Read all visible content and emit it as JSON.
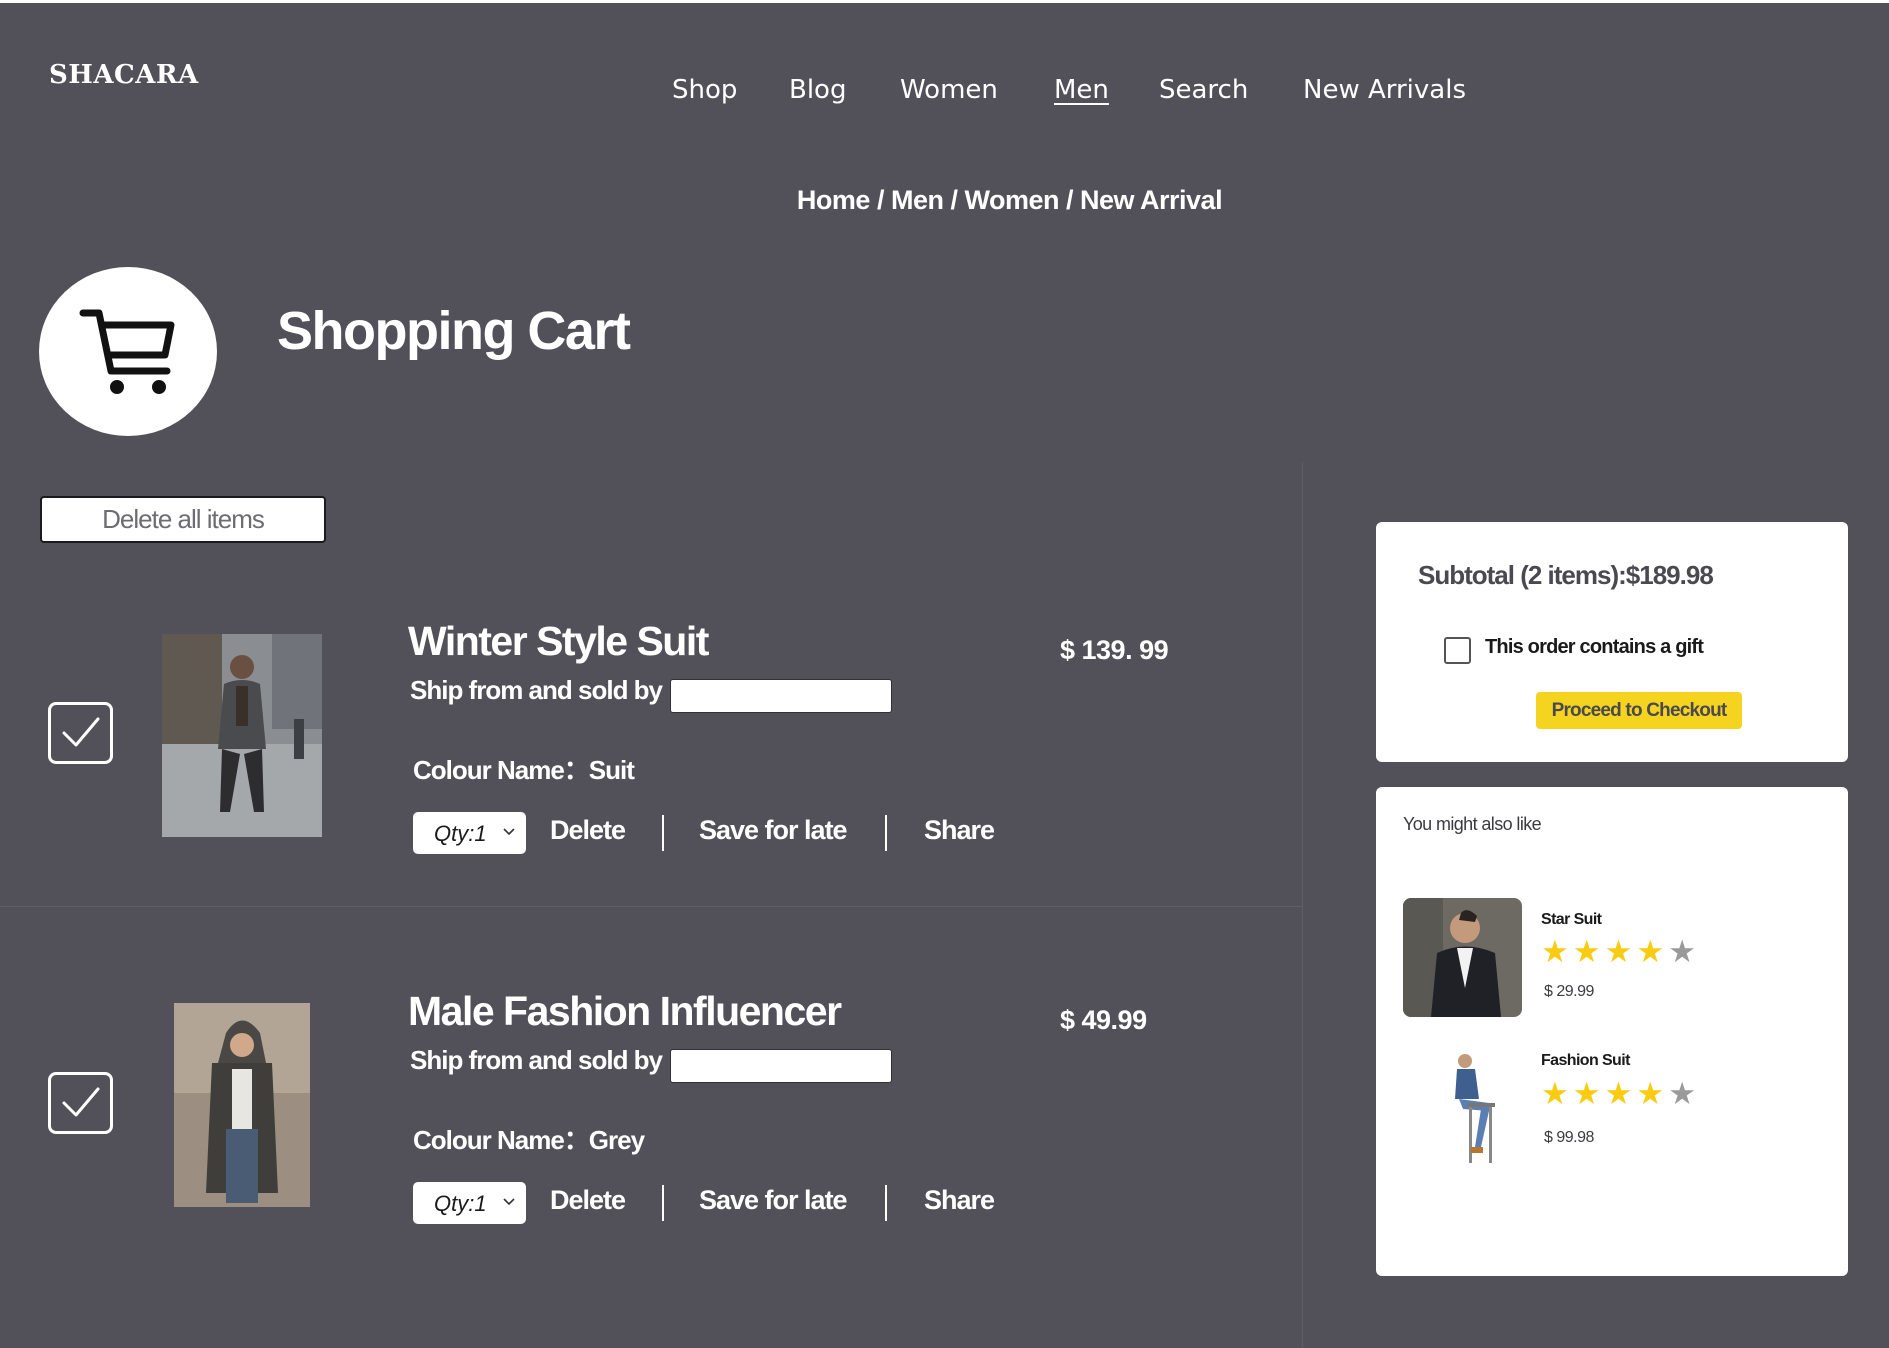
{
  "header": {
    "logo": "SHACARA",
    "nav": [
      {
        "label": "Shop",
        "active": false
      },
      {
        "label": "Blog",
        "active": false
      },
      {
        "label": "Women",
        "active": false
      },
      {
        "label": "Men",
        "active": true
      },
      {
        "label": "Search",
        "active": false
      },
      {
        "label": "New Arrivals",
        "active": false
      }
    ]
  },
  "breadcrumb": [
    "Home",
    "Men",
    "Women",
    "New Arrival"
  ],
  "page": {
    "title": "Shopping Cart",
    "delete_all_label": "Delete all items"
  },
  "cart_items": [
    {
      "name": "Winter Style Suit",
      "ship_label": "Ship from and sold by",
      "price": "$ 139. 99",
      "colour": "Colour Name：Suit",
      "qty": "Qty:1",
      "checked": true,
      "actions": {
        "delete": "Delete",
        "save": "Save for late",
        "share": "Share"
      }
    },
    {
      "name": "Male Fashion Influencer",
      "ship_label": "Ship from and sold by",
      "price": "$ 49.99",
      "colour": "Colour Name：Grey",
      "qty": "Qty:1",
      "checked": true,
      "actions": {
        "delete": "Delete",
        "save": "Save for late",
        "share": "Share"
      }
    }
  ],
  "summary": {
    "subtotal": "Subtotal (2 items):$189.98",
    "gift_label": "This order contains a gift",
    "gift_checked": false,
    "checkout_label": "Proceed to Checkout"
  },
  "recommendations": {
    "title": "You might also like",
    "items": [
      {
        "name": "Star Suit",
        "rating": 4,
        "max_rating": 5,
        "price": "$ 29.99"
      },
      {
        "name": "Fashion Suit",
        "rating": 4,
        "max_rating": 5,
        "price": "$ 99.98"
      }
    ]
  },
  "colors": {
    "background": "#525059",
    "panel": "#ffffff",
    "accent_yellow": "#f5d420",
    "star_filled": "#f7cc12",
    "star_empty": "#9a9a9a"
  }
}
